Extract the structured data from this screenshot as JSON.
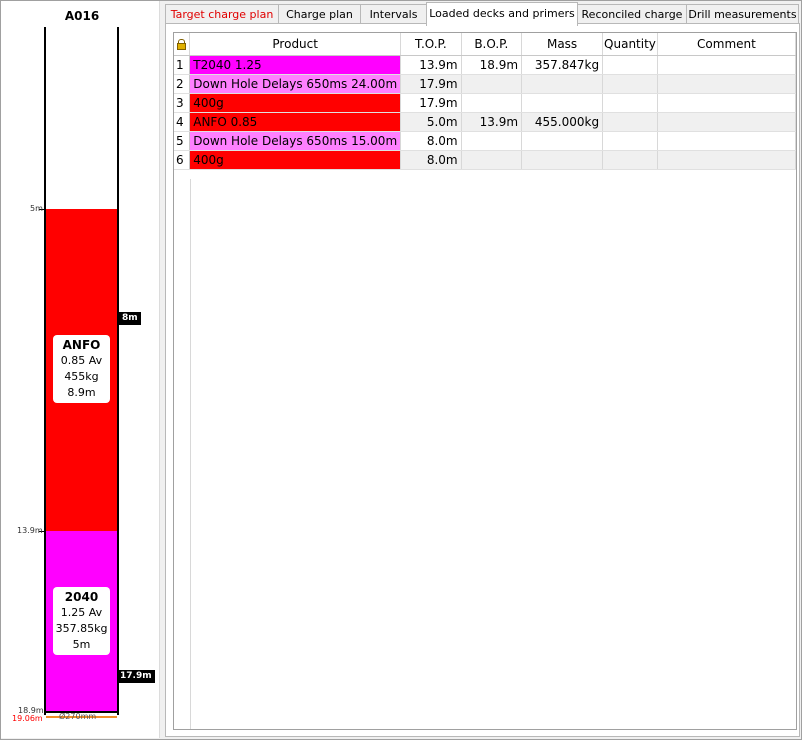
{
  "hole": {
    "id": "A016",
    "decks": [
      {
        "name": "ANFO",
        "density": "0.85 Av",
        "mass": "455kg",
        "length": "8.9m",
        "top_m": 5,
        "bottom_m": 13.9
      },
      {
        "name": "2040",
        "density": "1.25 Av",
        "mass": "357.85kg",
        "length": "5m",
        "top_m": 13.9,
        "bottom_m": 18.9
      }
    ],
    "depth_labels": {
      "d1": "5m",
      "d2": "13.9m",
      "d3": "18.9m",
      "d4": "19.06m"
    },
    "primers": [
      {
        "label": "8m",
        "depth_m": 8
      },
      {
        "label": "17.9m",
        "depth_m": 17.9
      }
    ],
    "diameter": "Ø270mm",
    "colors": {
      "anfo": "#ff0000",
      "t2040": "#ff00ff",
      "diameter_bar": "#f08c28"
    }
  },
  "tabs": [
    {
      "label": "Target charge plan",
      "warning": true,
      "active": false
    },
    {
      "label": "Charge plan",
      "warning": false,
      "active": false
    },
    {
      "label": "Intervals",
      "warning": false,
      "active": false
    },
    {
      "label": "Loaded decks and primers",
      "warning": false,
      "active": true
    },
    {
      "label": "Reconciled charge",
      "warning": false,
      "active": false
    },
    {
      "label": "Drill measurements",
      "warning": false,
      "active": false
    }
  ],
  "table": {
    "lock_icon": "lock-icon",
    "columns": [
      "Product",
      "T.O.P.",
      "B.O.P.",
      "Mass",
      "Quantity",
      "Comment"
    ],
    "rows": [
      {
        "idx": "1",
        "product": "T2040 1.25",
        "top": "13.9m",
        "bop": "18.9m",
        "mass": "357.847kg",
        "quantity": "",
        "comment": "",
        "color": "#ff00ff"
      },
      {
        "idx": "2",
        "product": "Down Hole Delays 650ms 24.00m",
        "top": "17.9m",
        "bop": "",
        "mass": "",
        "quantity": "",
        "comment": "",
        "color": "#ff80ff"
      },
      {
        "idx": "3",
        "product": "400g",
        "top": "17.9m",
        "bop": "",
        "mass": "",
        "quantity": "",
        "comment": "",
        "color": "#ff0000"
      },
      {
        "idx": "4",
        "product": "ANFO 0.85",
        "top": "5.0m",
        "bop": "13.9m",
        "mass": "455.000kg",
        "quantity": "",
        "comment": "",
        "color": "#ff0000"
      },
      {
        "idx": "5",
        "product": "Down Hole Delays 650ms 15.00m",
        "top": "8.0m",
        "bop": "",
        "mass": "",
        "quantity": "",
        "comment": "",
        "color": "#ff80ff"
      },
      {
        "idx": "6",
        "product": "400g",
        "top": "8.0m",
        "bop": "",
        "mass": "",
        "quantity": "",
        "comment": "",
        "color": "#ff0000"
      }
    ]
  }
}
